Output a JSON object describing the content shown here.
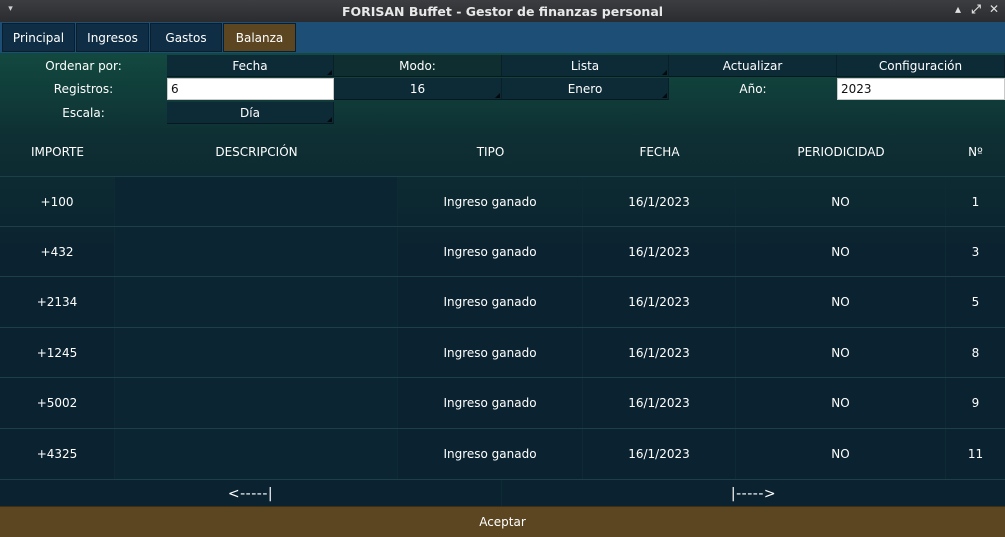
{
  "window": {
    "title": "FORISAN Buffet - Gestor de finanzas personal",
    "menu_glyph": "▾",
    "minimize_glyph": "▴",
    "maximize_glyph": "▴",
    "restore_glyph": "⤢",
    "close_glyph": "✕"
  },
  "tabs": [
    {
      "label": "Principal",
      "active": false
    },
    {
      "label": "Ingresos",
      "active": false
    },
    {
      "label": "Gastos",
      "active": false
    },
    {
      "label": "Balanza",
      "active": true
    }
  ],
  "controls": {
    "ordenar_label": "Ordenar por:",
    "ordenar_value": "Fecha",
    "modo_label": "Modo:",
    "modo_value": "Lista",
    "actualizar_label": "Actualizar",
    "configuracion_label": "Configuración",
    "registros_label": "Registros:",
    "registros_value": "6",
    "dia_value": "16",
    "mes_value": "Enero",
    "anio_label": "Año:",
    "anio_value": "2023",
    "escala_label": "Escala:",
    "escala_value": "Día"
  },
  "table": {
    "headers": {
      "importe": "IMPORTE",
      "descripcion": "DESCRIPCIÓN",
      "tipo": "TIPO",
      "fecha": "FECHA",
      "periodicidad": "PERIODICIDAD",
      "numero": "Nº"
    },
    "rows": [
      {
        "importe": "+100",
        "descripcion": "",
        "tipo": "Ingreso ganado",
        "fecha": "16/1/2023",
        "periodicidad": "NO",
        "numero": "1"
      },
      {
        "importe": "+432",
        "descripcion": "",
        "tipo": "Ingreso ganado",
        "fecha": "16/1/2023",
        "periodicidad": "NO",
        "numero": "3"
      },
      {
        "importe": "+2134",
        "descripcion": "",
        "tipo": "Ingreso ganado",
        "fecha": "16/1/2023",
        "periodicidad": "NO",
        "numero": "5"
      },
      {
        "importe": "+1245",
        "descripcion": "",
        "tipo": "Ingreso ganado",
        "fecha": "16/1/2023",
        "periodicidad": "NO",
        "numero": "8"
      },
      {
        "importe": "+5002",
        "descripcion": "",
        "tipo": "Ingreso ganado",
        "fecha": "16/1/2023",
        "periodicidad": "NO",
        "numero": "9"
      },
      {
        "importe": "+4325",
        "descripcion": "",
        "tipo": "Ingreso ganado",
        "fecha": "16/1/2023",
        "periodicidad": "NO",
        "numero": "11"
      }
    ]
  },
  "pager": {
    "prev": "<-----|",
    "next": "|----->"
  },
  "footer": {
    "accept_label": "Aceptar"
  },
  "colors": {
    "tab_bar": "#1d4e76",
    "tab": "#0f2e45",
    "tab_active": "#5c4521",
    "background": "#0b2330",
    "accept": "#5c4521"
  }
}
